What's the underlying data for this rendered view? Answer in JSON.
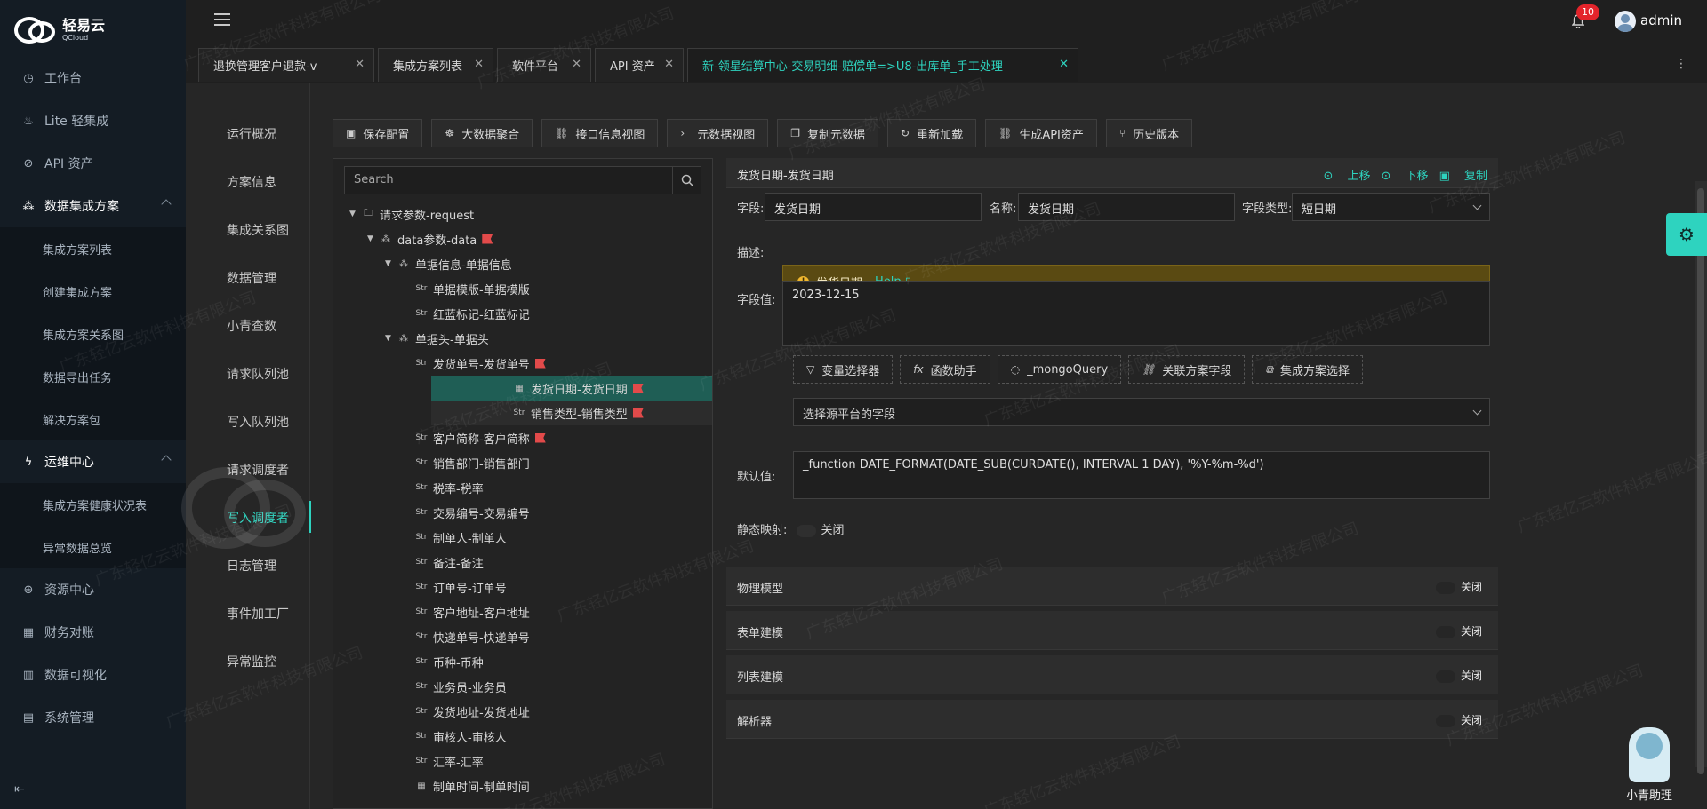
{
  "brand": {
    "name": "轻易云",
    "sub": "QCloud"
  },
  "sidebar": {
    "items": [
      {
        "label": "工作台",
        "icon": "clock-icon",
        "group": false
      },
      {
        "label": "Lite 轻集成",
        "icon": "lamp-icon",
        "group": false
      },
      {
        "label": "API 资产",
        "icon": "compass-icon",
        "group": false
      },
      {
        "label": "数据集成方案",
        "icon": "share-icon",
        "group": true
      },
      {
        "label": "集成方案列表",
        "sub": true
      },
      {
        "label": "创建集成方案",
        "sub": true
      },
      {
        "label": "集成方案关系图",
        "sub": true
      },
      {
        "label": "数据导出任务",
        "sub": true
      },
      {
        "label": "解决方案包",
        "sub": true
      },
      {
        "label": "运维中心",
        "icon": "bolt-icon",
        "group": true
      },
      {
        "label": "集成方案健康状况表",
        "sub": true
      },
      {
        "label": "异常数据总览",
        "sub": true
      },
      {
        "label": "资源中心",
        "icon": "globe-icon",
        "group": false
      },
      {
        "label": "财务对账",
        "icon": "calculator-icon",
        "group": false
      },
      {
        "label": "数据可视化",
        "icon": "chart-icon",
        "group": false
      },
      {
        "label": "系统管理",
        "icon": "grid-icon",
        "group": false
      }
    ]
  },
  "header": {
    "notifications": "10",
    "username": "admin"
  },
  "tabs": [
    {
      "label": "退换管理客户退款-v",
      "active": false
    },
    {
      "label": "集成方案列表",
      "active": false
    },
    {
      "label": "软件平台",
      "active": false
    },
    {
      "label": "API 资产",
      "active": false
    },
    {
      "label": "新-领星结算中心-交易明细-赔偿单=>U8-出库单_手工处理",
      "active": true
    }
  ],
  "inner_nav": [
    "运行概况",
    "方案信息",
    "集成关系图",
    "数据管理",
    "小青查数",
    "请求队列池",
    "写入队列池",
    "请求调度者",
    "写入调度者",
    "日志管理",
    "事件加工厂",
    "异常监控"
  ],
  "inner_nav_active": "写入调度者",
  "toolbar": [
    {
      "label": "保存配置",
      "icon": "save-icon"
    },
    {
      "label": "大数据聚合",
      "icon": "database-icon"
    },
    {
      "label": "接口信息视图",
      "icon": "link-icon"
    },
    {
      "label": "元数据视图",
      "icon": "terminal-icon"
    },
    {
      "label": "复制元数据",
      "icon": "copy-icon"
    },
    {
      "label": "重新加载",
      "icon": "reload-icon"
    },
    {
      "label": "生成API资产",
      "icon": "link-icon"
    },
    {
      "label": "历史版本",
      "icon": "branch-icon"
    }
  ],
  "search": {
    "placeholder": "Search"
  },
  "tree": [
    {
      "indent": 0,
      "label": "请求参数-request",
      "icon": "folder",
      "toggle": "open",
      "flag": false
    },
    {
      "indent": 1,
      "label": "data参数-data",
      "icon": "tree",
      "toggle": "open",
      "flag": true
    },
    {
      "indent": 2,
      "label": "单据信息-单据信息",
      "icon": "tree",
      "toggle": "open",
      "flag": false
    },
    {
      "indent": 3,
      "label": "单据模版-单据模版",
      "icon": "str",
      "flag": false
    },
    {
      "indent": 3,
      "label": "红蓝标记-红蓝标记",
      "icon": "str",
      "flag": false
    },
    {
      "indent": 2,
      "label": "单据头-单据头",
      "icon": "tree",
      "toggle": "open",
      "flag": false
    },
    {
      "indent": 3,
      "label": "发货单号-发货单号",
      "icon": "str",
      "flag": true
    },
    {
      "indent": 3,
      "label": "发货日期-发货日期",
      "icon": "date",
      "flag": true,
      "selected": true
    },
    {
      "indent": 3,
      "label": "销售类型-销售类型",
      "icon": "str",
      "flag": true,
      "hover": true
    },
    {
      "indent": 3,
      "label": "客户简称-客户简称",
      "icon": "str",
      "flag": true
    },
    {
      "indent": 3,
      "label": "销售部门-销售部门",
      "icon": "str",
      "flag": false
    },
    {
      "indent": 3,
      "label": "税率-税率",
      "icon": "str",
      "flag": false
    },
    {
      "indent": 3,
      "label": "交易编号-交易编号",
      "icon": "str",
      "flag": false
    },
    {
      "indent": 3,
      "label": "制单人-制单人",
      "icon": "str",
      "flag": false
    },
    {
      "indent": 3,
      "label": "备注-备注",
      "icon": "str",
      "flag": false
    },
    {
      "indent": 3,
      "label": "订单号-订单号",
      "icon": "str",
      "flag": false
    },
    {
      "indent": 3,
      "label": "客户地址-客户地址",
      "icon": "str",
      "flag": false
    },
    {
      "indent": 3,
      "label": "快递单号-快递单号",
      "icon": "str",
      "flag": false
    },
    {
      "indent": 3,
      "label": "币种-币种",
      "icon": "str",
      "flag": false
    },
    {
      "indent": 3,
      "label": "业务员-业务员",
      "icon": "str",
      "flag": false
    },
    {
      "indent": 3,
      "label": "发货地址-发货地址",
      "icon": "str",
      "flag": false
    },
    {
      "indent": 3,
      "label": "审核人-审核人",
      "icon": "str",
      "flag": false
    },
    {
      "indent": 3,
      "label": "汇率-汇率",
      "icon": "str",
      "flag": false
    },
    {
      "indent": 3,
      "label": "制单时间-制单时间",
      "icon": "date",
      "flag": false
    }
  ],
  "detail": {
    "title": "发货日期-发货日期",
    "actions": {
      "up": "上移",
      "down": "下移",
      "copy": "复制"
    },
    "field_label": "字段:",
    "field_value": "发货日期",
    "name_label": "名称:",
    "name_value": "发货日期",
    "type_label": "字段类型:",
    "type_value": "短日期",
    "desc_label": "描述:",
    "desc_value": "发货日期",
    "desc_help": "Help",
    "value_label": "字段值:",
    "value_text": "2023-12-15",
    "buttons": [
      {
        "label": "变量选择器",
        "icon": "filter-icon"
      },
      {
        "label": "函数助手",
        "icon": "function-icon"
      },
      {
        "label": "_mongoQuery",
        "icon": "bulb-icon"
      },
      {
        "label": "关联方案字段",
        "icon": "link-icon"
      },
      {
        "label": "集成方案选择",
        "icon": "tag-icon"
      }
    ],
    "source_placeholder": "选择源平台的字段",
    "default_label": "默认值:",
    "default_value": "_function DATE_FORMAT(DATE_SUB(CURDATE(), INTERVAL 1 DAY), '%Y-%m-%d')",
    "static_label": "静态映射:",
    "static_value": "关闭"
  },
  "sections": [
    {
      "title": "物理模型",
      "state": "关闭"
    },
    {
      "title": "表单建模",
      "state": "关闭"
    },
    {
      "title": "列表建模",
      "state": "关闭"
    },
    {
      "title": "解析器",
      "state": "关闭"
    }
  ],
  "assistant": {
    "name": "小青助理"
  },
  "watermark": "广东轻亿云软件科技有限公司",
  "colors": {
    "accent": "#2ed3bf",
    "sidebar": "#141c24",
    "badge": "#e3242b",
    "warning_bg": "#5a4a12"
  }
}
